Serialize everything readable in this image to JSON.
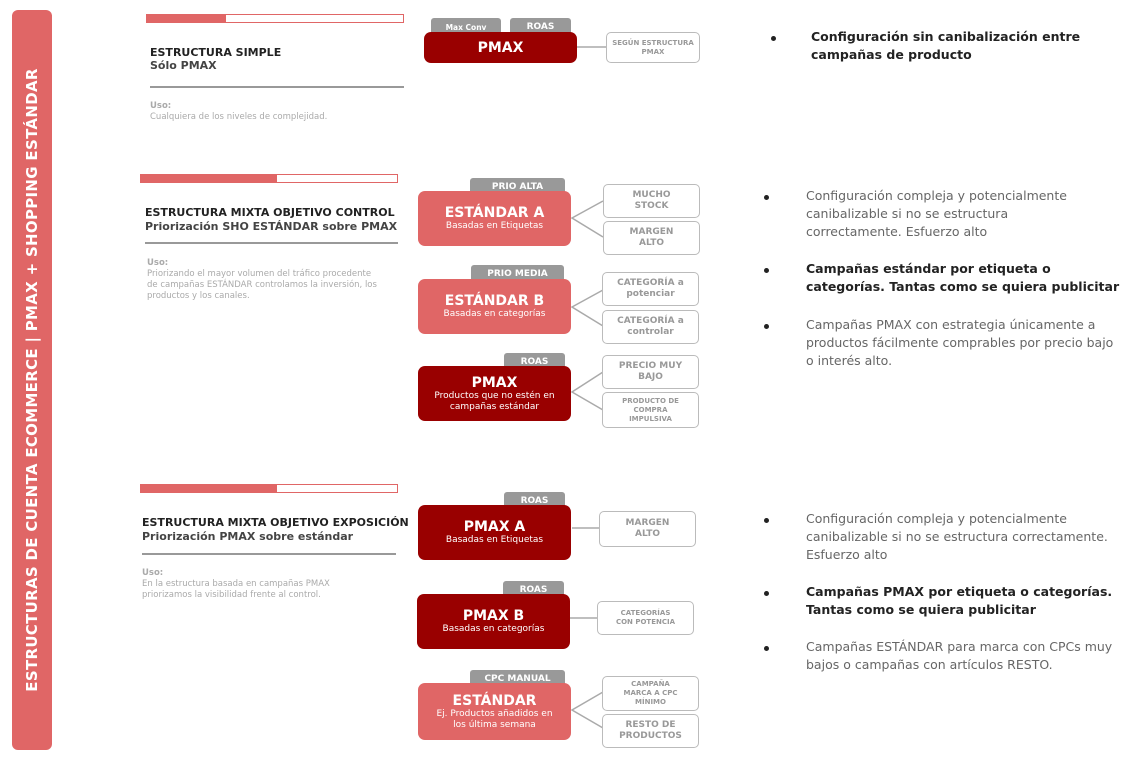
{
  "sidebar": {
    "title": "ESTRUCTURAS DE CUENTA ECOMMERCE | PMAX + SHOPPING ESTÁNDAR"
  },
  "colors": {
    "accent": "#e06666",
    "dark": "#990000",
    "tag": "#999999",
    "muted": "#aaaaaa"
  },
  "sections": [
    {
      "title": "ESTRUCTURA SIMPLE",
      "subtitle": "Sólo PMAX",
      "uso_label": "Uso:",
      "uso_text": "Cualquiera de los niveles de complejidad.",
      "campaigns": [
        {
          "tags": [
            "Max Conv",
            "ROAS"
          ],
          "name": "PMAX",
          "desc": "",
          "leaves": [
            "SEGÚN ESTRUCTURA PMAX"
          ]
        }
      ],
      "bullets": [
        {
          "text": "Configuración sin canibalización entre campañas de producto",
          "bold": true
        }
      ]
    },
    {
      "title": "ESTRUCTURA MIXTA OBJETIVO CONTROL",
      "subtitle": "Priorización SHO ESTÁNDAR sobre PMAX",
      "uso_label": "Uso:",
      "uso_text": "Priorizando el mayor volumen del tráfico procedente de campañas ESTÁNDAR controlamos la inversión, los productos y los canales.",
      "campaigns": [
        {
          "tags": [
            "PRIO ALTA"
          ],
          "name": "ESTÁNDAR A",
          "desc": "Basadas en Etiquetas",
          "leaves": [
            "MUCHO STOCK",
            "MARGEN ALTO"
          ]
        },
        {
          "tags": [
            "PRIO MEDIA"
          ],
          "name": "ESTÁNDAR B",
          "desc": "Basadas en categorías",
          "leaves": [
            "CATEGORÍA a potenciar",
            "CATEGORÍA a controlar"
          ]
        },
        {
          "tags": [
            "ROAS"
          ],
          "name": "PMAX",
          "desc": "Productos que no estén en campañas estándar",
          "leaves": [
            "PRECIO MUY BAJO",
            "PRODUCTO DE COMPRA IMPULSIVA"
          ]
        }
      ],
      "bullets": [
        {
          "text": "Configuración compleja y potencialmente canibalizable si no se estructura correctamente. Esfuerzo alto",
          "bold": false
        },
        {
          "text": "Campañas estándar por etiqueta o categorías. Tantas como se quiera publicitar",
          "bold": true
        },
        {
          "text": "Campañas PMAX con estrategia únicamente a productos fácilmente comprables por precio bajo o interés alto.",
          "bold": false
        }
      ]
    },
    {
      "title": "ESTRUCTURA MIXTA OBJETIVO EXPOSICIÓN",
      "subtitle": "Priorización PMAX sobre estándar",
      "uso_label": "Uso:",
      "uso_text": "En la estructura basada en campañas PMAX priorizamos la visibilidad frente al control.",
      "campaigns": [
        {
          "tags": [
            "ROAS"
          ],
          "name": "PMAX A",
          "desc": "Basadas en Etiquetas",
          "leaves": [
            "MARGEN ALTO"
          ]
        },
        {
          "tags": [
            "ROAS"
          ],
          "name": "PMAX B",
          "desc": "Basadas en categorías",
          "leaves": [
            "CATEGORÍAS CON POTENCIA"
          ]
        },
        {
          "tags": [
            "CPC MANUAL"
          ],
          "name": "ESTÁNDAR",
          "desc": "Ej. Productos añadidos en los última semana",
          "leaves": [
            "CAMPAÑA MARCA A CPC MÍNIMO",
            "RESTO DE PRODUCTOS"
          ]
        }
      ],
      "bullets": [
        {
          "text": "Configuración compleja y potencialmente canibalizable si no se estructura correctamente. Esfuerzo alto",
          "bold": false
        },
        {
          "text": "Campañas PMAX por etiqueta o categorías. Tantas como se quiera publicitar",
          "bold": true
        },
        {
          "text": "Campañas ESTÁNDAR para marca con CPCs muy bajos o campañas con artículos RESTO.",
          "bold": false
        }
      ]
    }
  ]
}
